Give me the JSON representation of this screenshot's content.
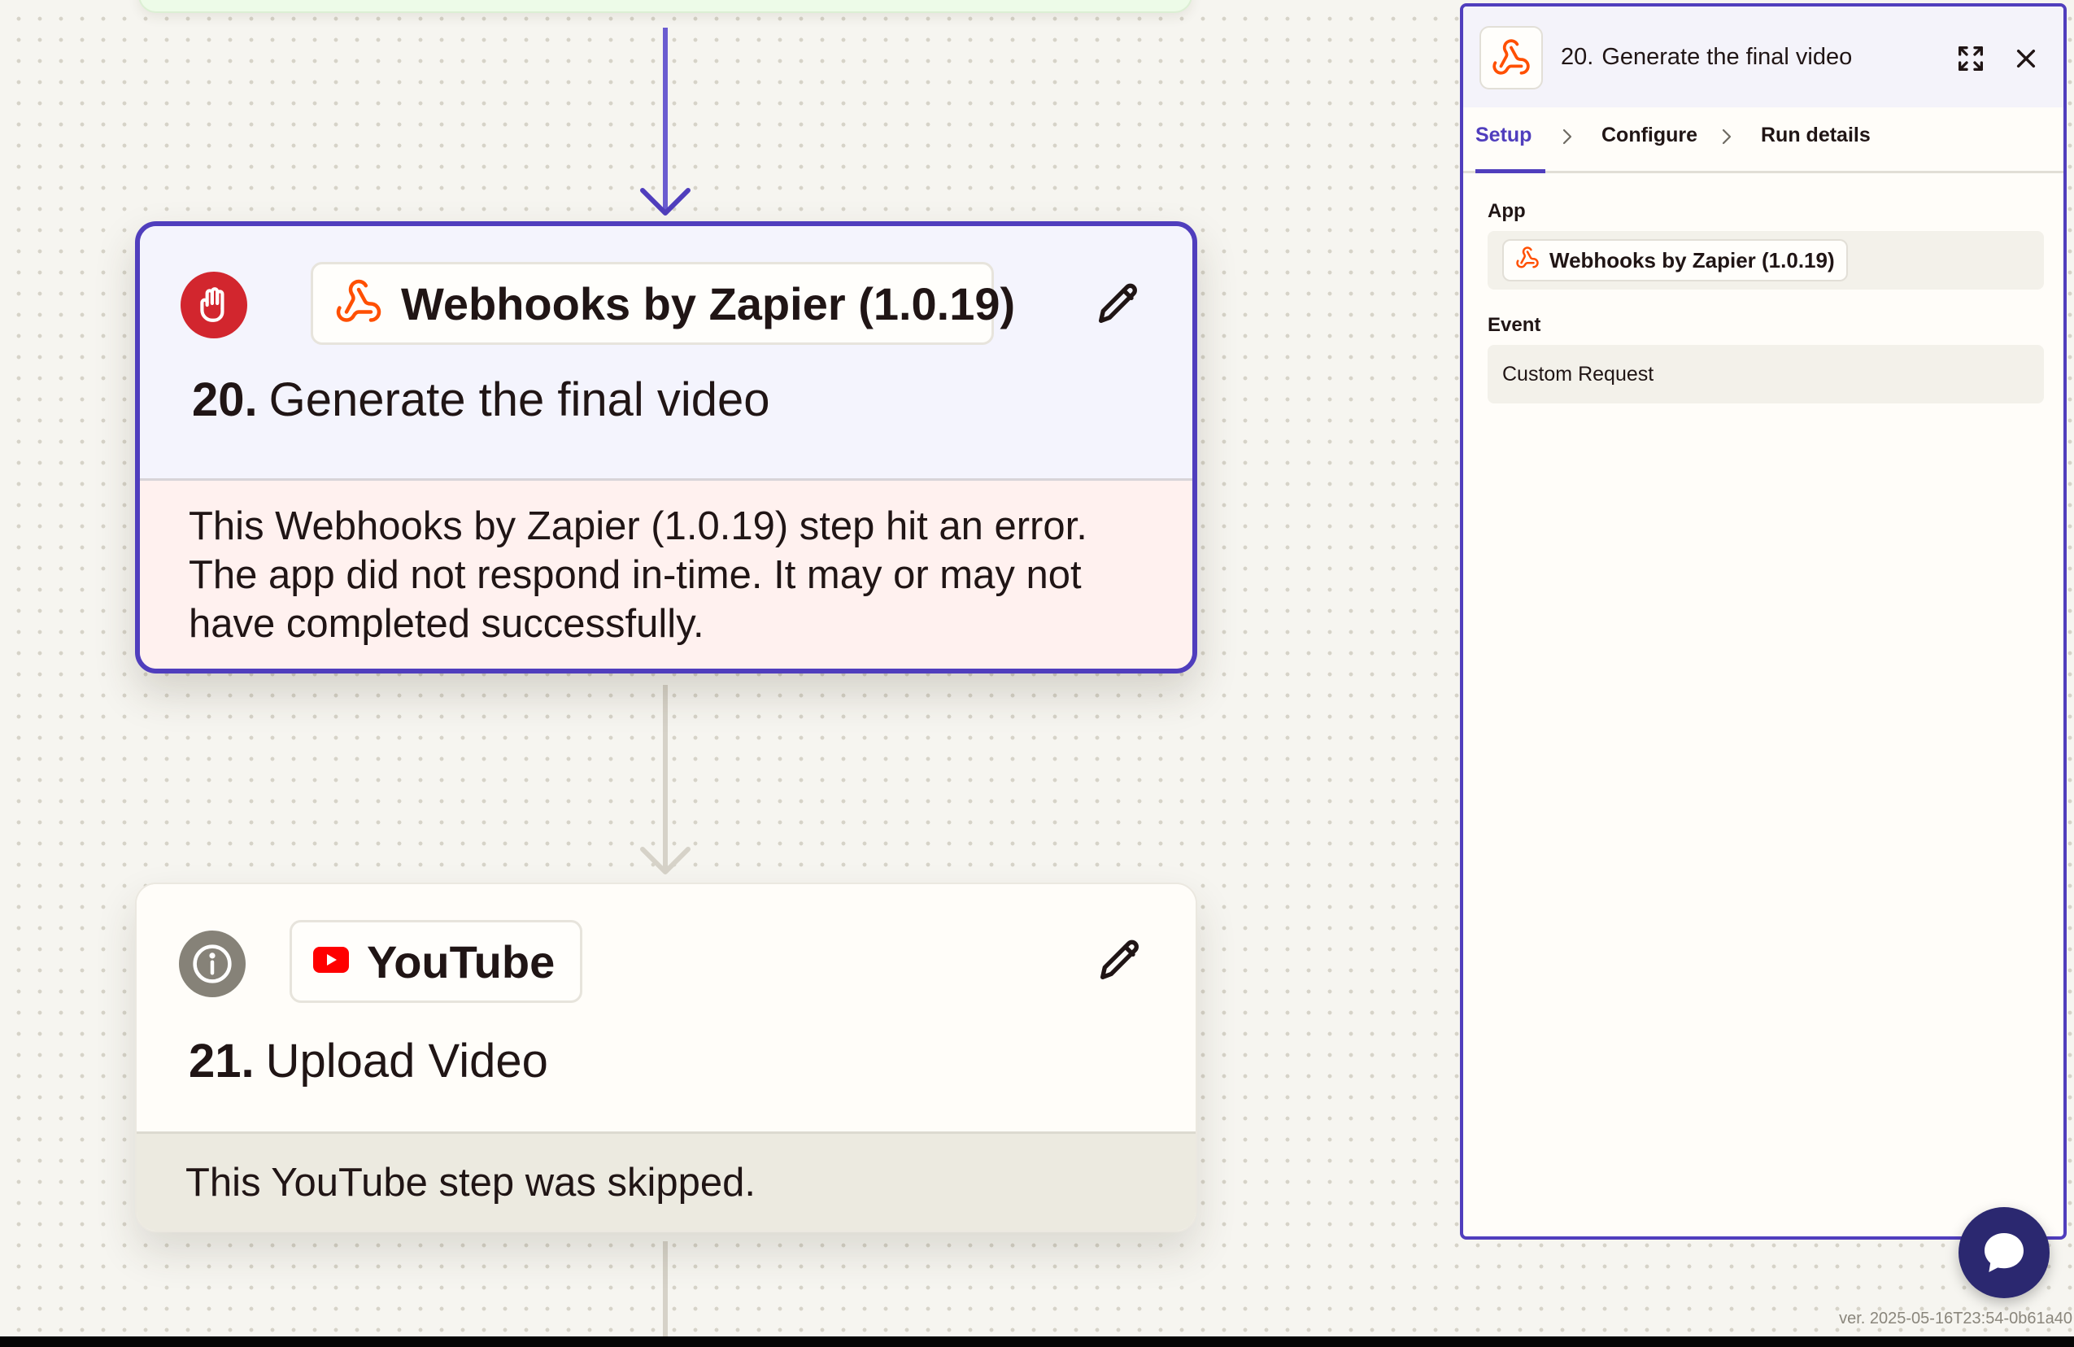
{
  "colors": {
    "accent": "#503ebd",
    "error": "#d2262e",
    "webhook_orange": "#ff4f00",
    "youtube_red": "#ff0000",
    "error_bg": "#fff1ef",
    "skipped_bg": "#eceae0"
  },
  "steps": [
    {
      "number": "20.",
      "title": "Generate the final video",
      "app": "Webhooks by Zapier (1.0.19)",
      "status_icon": "error-hand-icon",
      "app_icon": "webhook-icon",
      "message": "This Webhooks by Zapier (1.0.19) step hit an error. The app did not respond in-time. It may or may not have completed successfully."
    },
    {
      "number": "21.",
      "title": "Upload Video",
      "app": "YouTube",
      "status_icon": "info-icon",
      "app_icon": "youtube-icon",
      "message": "This YouTube step was skipped."
    }
  ],
  "panel": {
    "step_number": "20.",
    "title": "Generate the final video",
    "tabs": [
      {
        "label": "Setup",
        "active": true
      },
      {
        "label": "Configure",
        "active": false
      },
      {
        "label": "Run details",
        "active": false
      }
    ],
    "app_label": "App",
    "app_value": "Webhooks by Zapier (1.0.19)",
    "event_label": "Event",
    "event_value": "Custom Request"
  },
  "version": "ver. 2025-05-16T23:54-0b61a40"
}
